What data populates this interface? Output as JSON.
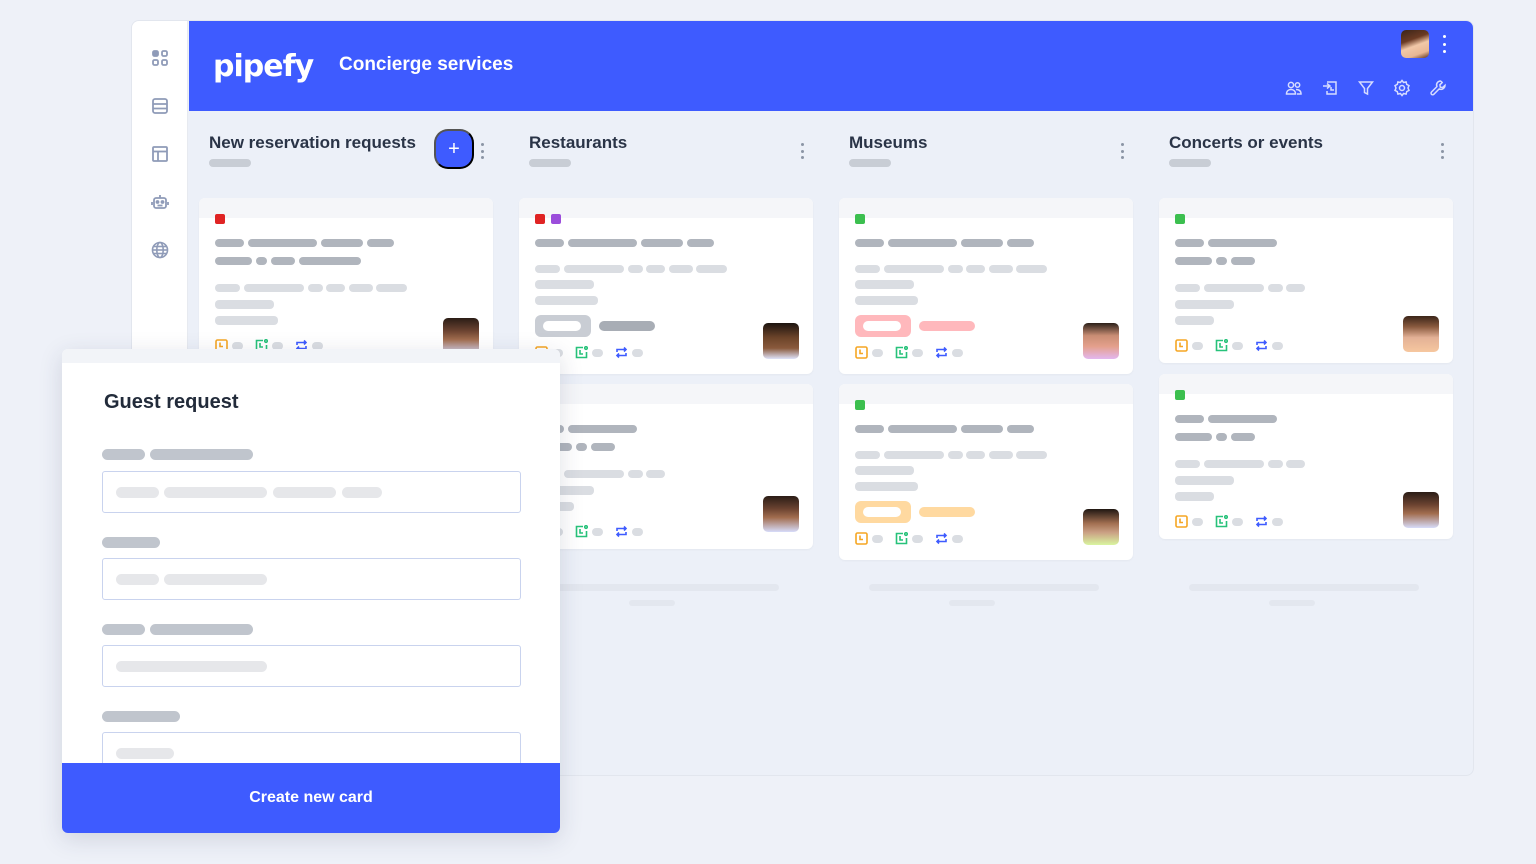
{
  "app": {
    "logo": "pipefy",
    "pipe_title": "Concierge services",
    "brand_color": "#3e5bff"
  },
  "sidebar": {
    "items": [
      {
        "icon": "apps-grid-icon"
      },
      {
        "icon": "database-icon"
      },
      {
        "icon": "layout-icon"
      },
      {
        "icon": "robot-icon"
      },
      {
        "icon": "globe-icon"
      }
    ]
  },
  "header": {
    "actions": [
      {
        "icon": "members-icon"
      },
      {
        "icon": "import-icon"
      },
      {
        "icon": "filter-icon"
      },
      {
        "icon": "settings-icon"
      },
      {
        "icon": "wrench-icon"
      }
    ]
  },
  "columns": [
    {
      "title": "New reservation requests",
      "add_label": "+"
    },
    {
      "title": "Restaurants"
    },
    {
      "title": "Museums"
    },
    {
      "title": "Concerts or events"
    }
  ],
  "tag_colors": {
    "red": "#e02424",
    "purple": "#9b4ddb",
    "green": "#3cbf4f"
  },
  "status_colors": {
    "pink": "#ffb8bc",
    "orange": "#ffd9a0"
  },
  "modal": {
    "title": "Guest request",
    "submit_label": "Create new card"
  }
}
